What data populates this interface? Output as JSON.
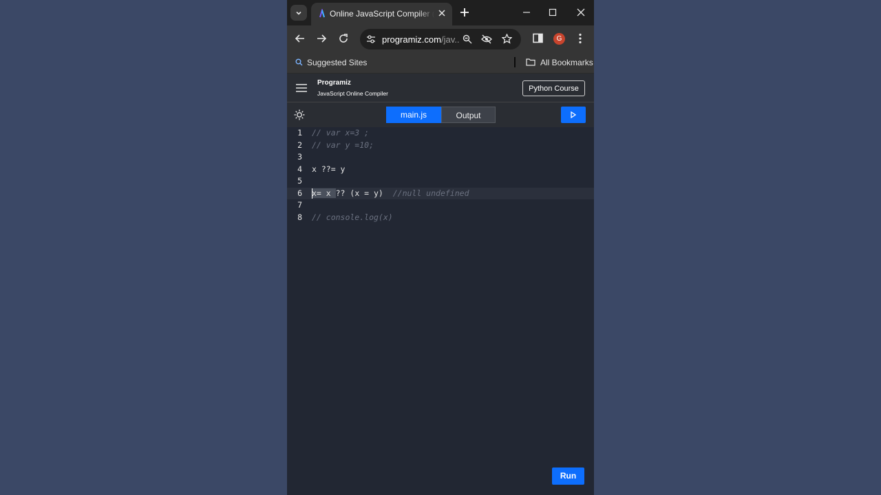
{
  "browser": {
    "tab_title": "Online JavaScript Compiler (Editor)",
    "url_host": "programiz.com",
    "url_rest": "/jav...",
    "avatar_letter": "G",
    "bookmarks": {
      "suggested": "Suggested Sites",
      "all": "All Bookmarks"
    }
  },
  "site": {
    "logo": "Programiz",
    "subtitle": "JavaScript Online Compiler",
    "course_button": "Python Course"
  },
  "compiler": {
    "file_tab": "main.js",
    "output_tab": "Output",
    "run_label": "Run"
  },
  "editor": {
    "lines": [
      {
        "num": "1",
        "code": "",
        "comment": "// var x=3 ;"
      },
      {
        "num": "2",
        "code": "",
        "comment": "// var y =10;"
      },
      {
        "num": "3",
        "code": "",
        "comment": ""
      },
      {
        "num": "4",
        "code": "x ??= y",
        "comment": ""
      },
      {
        "num": "5",
        "code": "",
        "comment": ""
      },
      {
        "num": "6",
        "selected": "x= x ",
        "code": "?? (x = y)  ",
        "comment": "//null undefined"
      },
      {
        "num": "7",
        "code": "",
        "comment": ""
      },
      {
        "num": "8",
        "code": "",
        "comment": "// console.log(x)"
      }
    ]
  },
  "colors": {
    "accent": "#0d6efd",
    "desktop": "#3b4866",
    "editor_bg": "#222733"
  }
}
